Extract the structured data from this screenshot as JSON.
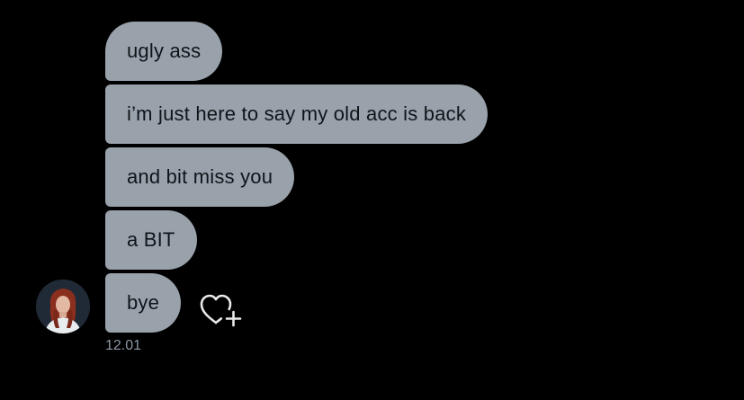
{
  "conversation": {
    "messages": [
      {
        "text": "ugly ass"
      },
      {
        "text": "i’m just here to say my old acc is back"
      },
      {
        "text": "and bit miss you"
      },
      {
        "text": "a BIT"
      },
      {
        "text": "bye"
      }
    ],
    "timestamp": "12.01",
    "avatar_icon": "user-avatar",
    "reaction_icon": "heart-plus-icon"
  },
  "colors": {
    "background": "#000000",
    "bubble": "#99a2ab",
    "bubble_text": "#0f1419",
    "timestamp": "#8b98a5"
  }
}
